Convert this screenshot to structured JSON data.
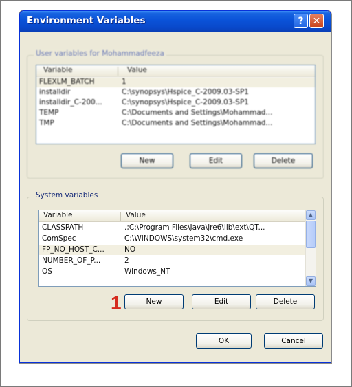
{
  "window": {
    "title": "Environment Variables",
    "help_label": "?",
    "close_label": "✕"
  },
  "user_vars": {
    "label": "User variables for Mohammadfeeza",
    "columns": [
      "Variable",
      "Value"
    ],
    "rows": [
      {
        "variable": "FLEXLM_BATCH",
        "value": "1"
      },
      {
        "variable": "installdir",
        "value": "C:\\synopsys\\Hspice_C-2009.03-SP1"
      },
      {
        "variable": "installdir_C-200...",
        "value": "C:\\synopsys\\Hspice_C-2009.03-SP1"
      },
      {
        "variable": "TEMP",
        "value": "C:\\Documents and Settings\\Mohammad..."
      },
      {
        "variable": "TMP",
        "value": "C:\\Documents and Settings\\Mohammad..."
      }
    ],
    "buttons": {
      "new": "New",
      "edit": "Edit",
      "delete": "Delete"
    }
  },
  "system_vars": {
    "label": "System variables",
    "columns": [
      "Variable",
      "Value"
    ],
    "rows": [
      {
        "variable": "CLASSPATH",
        "value": ".;C:\\Program Files\\Java\\jre6\\lib\\ext\\QT..."
      },
      {
        "variable": "ComSpec",
        "value": "C:\\WINDOWS\\system32\\cmd.exe"
      },
      {
        "variable": "FP_NO_HOST_C...",
        "value": "NO"
      },
      {
        "variable": "NUMBER_OF_P...",
        "value": "2"
      },
      {
        "variable": "OS",
        "value": "Windows_NT"
      }
    ],
    "buttons": {
      "new": "New",
      "edit": "Edit",
      "delete": "Delete"
    }
  },
  "dialog_buttons": {
    "ok": "OK",
    "cancel": "Cancel"
  },
  "annotation": {
    "marker": "1"
  }
}
